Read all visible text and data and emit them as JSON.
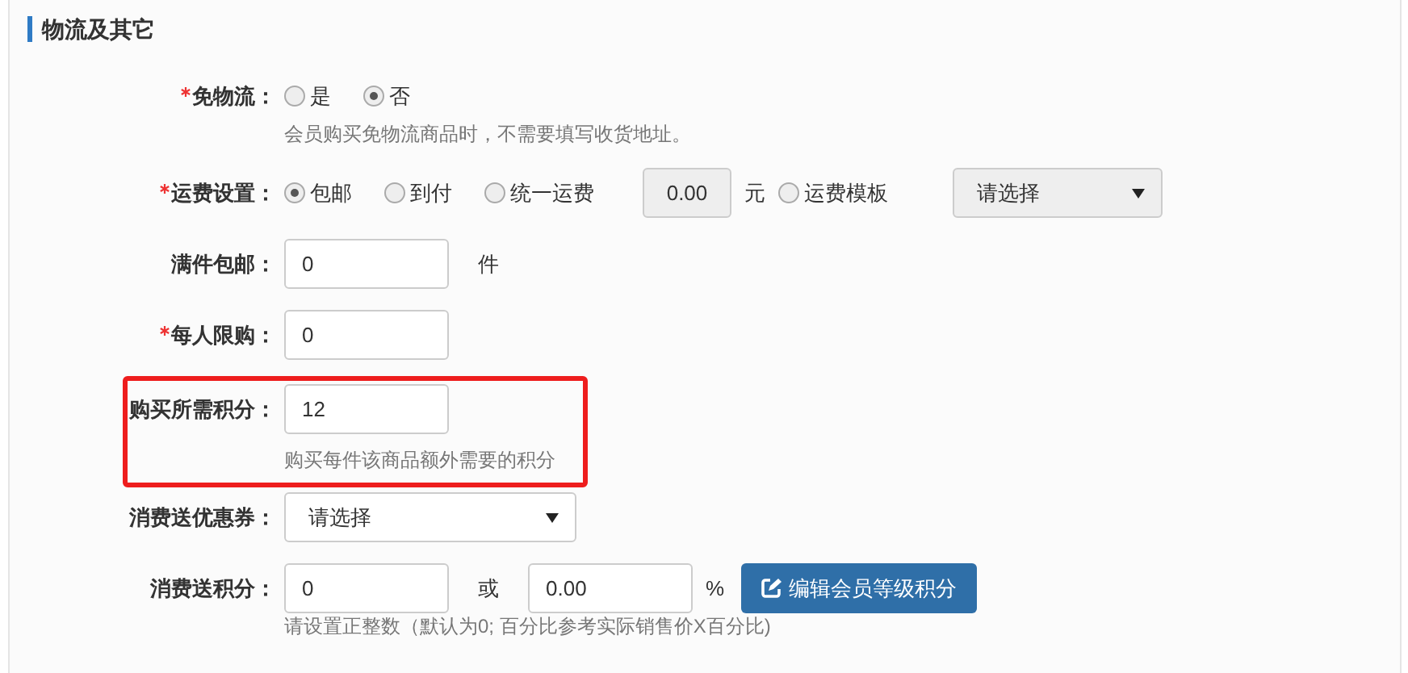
{
  "section": {
    "title": "物流及其它"
  },
  "fields": [
    {
      "label": "免物流：",
      "required": true,
      "highlighted": false,
      "hint": "会员购买免物流商品时，不需要填写收货地址。",
      "controls": [
        {
          "kind": "radio",
          "label": "是",
          "selected": false
        },
        {
          "kind": "radio",
          "label": "否",
          "selected": true
        }
      ]
    },
    {
      "label": "运费设置：",
      "required": true,
      "highlighted": false,
      "controls": [
        {
          "kind": "radio",
          "label": "包邮",
          "selected": true
        },
        {
          "kind": "radio",
          "label": "到付",
          "selected": false
        },
        {
          "kind": "radio",
          "label": "统一运费",
          "selected": false
        },
        {
          "kind": "input",
          "value": "0.00",
          "disabled": true
        },
        {
          "kind": "unit",
          "text": "元"
        },
        {
          "kind": "radio",
          "label": "运费模板",
          "selected": false
        },
        {
          "kind": "select",
          "value": "请选择",
          "disabled": true
        }
      ]
    },
    {
      "label": "满件包邮：",
      "required": false,
      "highlighted": false,
      "controls": [
        {
          "kind": "input",
          "value": "0",
          "disabled": false
        },
        {
          "kind": "unit",
          "text": "件"
        }
      ]
    },
    {
      "label": "每人限购：",
      "required": true,
      "highlighted": false,
      "controls": [
        {
          "kind": "input",
          "value": "0",
          "disabled": false
        }
      ]
    },
    {
      "label": "购买所需积分：",
      "required": false,
      "highlighted": true,
      "hint": "购买每件该商品额外需要的积分",
      "controls": [
        {
          "kind": "input",
          "value": "12",
          "disabled": false
        }
      ]
    },
    {
      "label": "消费送优惠券：",
      "required": false,
      "highlighted": false,
      "controls": [
        {
          "kind": "select",
          "value": "请选择",
          "disabled": false
        }
      ]
    },
    {
      "label": "消费送积分：",
      "required": false,
      "highlighted": false,
      "hint": "请设置正整数（默认为0; 百分比参考实际销售价X百分比)",
      "controls": [
        {
          "kind": "input",
          "value": "0",
          "disabled": false
        },
        {
          "kind": "unit",
          "text": "或"
        },
        {
          "kind": "input",
          "value": "0.00",
          "disabled": false
        },
        {
          "kind": "unit",
          "text": "%"
        },
        {
          "kind": "button",
          "label": "编辑会员等级积分"
        }
      ]
    }
  ]
}
